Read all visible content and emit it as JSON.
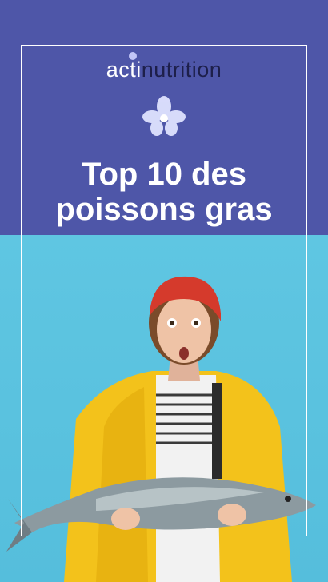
{
  "brand": {
    "logo_part1": "acti",
    "logo_part2": "nutrition",
    "flower_icon": "orchid-flower-icon"
  },
  "headline": {
    "line1": "Top 10 des",
    "line2": "poissons gras"
  },
  "colors": {
    "panel": "#4e56a8",
    "background": "#5cc3e0",
    "logo_dark": "#1d1f4a",
    "text": "#ffffff"
  },
  "photo": {
    "subject": "photo-woman-holding-salmon"
  }
}
